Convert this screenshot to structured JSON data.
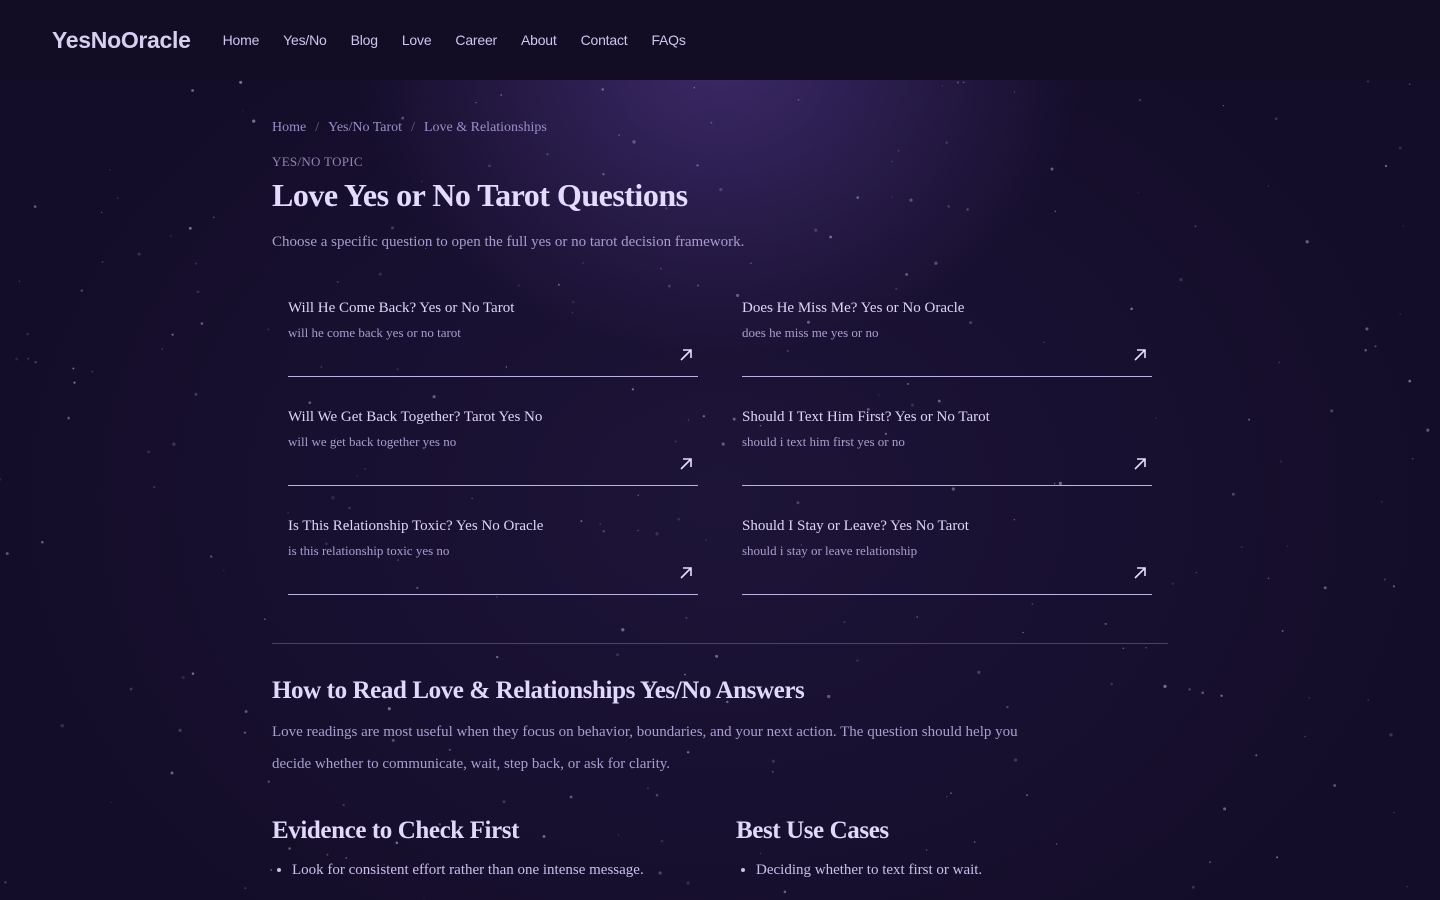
{
  "site": {
    "brand": "YesNoOracle",
    "nav": [
      "Home",
      "Yes/No",
      "Blog",
      "Love",
      "Career",
      "About",
      "Contact",
      "FAQs"
    ]
  },
  "breadcrumb": [
    "Home",
    "Yes/No Tarot",
    "Love & Relationships"
  ],
  "eyebrow": "YES/NO TOPIC",
  "title": "Love Yes or No Tarot Questions",
  "intro": "Choose a specific question to open the full yes or no tarot decision framework.",
  "cards": [
    {
      "title": "Will He Come Back? Yes or No Tarot",
      "subtitle": "will he come back yes or no tarot"
    },
    {
      "title": "Does He Miss Me? Yes or No Oracle",
      "subtitle": "does he miss me yes or no"
    },
    {
      "title": "Will We Get Back Together? Tarot Yes No",
      "subtitle": "will we get back together yes no"
    },
    {
      "title": "Should I Text Him First? Yes or No Tarot",
      "subtitle": "should i text him first yes or no"
    },
    {
      "title": "Is This Relationship Toxic? Yes No Oracle",
      "subtitle": "is this relationship toxic yes no"
    },
    {
      "title": "Should I Stay or Leave? Yes No Tarot",
      "subtitle": "should i stay or leave relationship"
    }
  ],
  "howto": {
    "heading": "How to Read Love & Relationships Yes/No Answers",
    "body": "Love readings are most useful when they focus on behavior, boundaries, and your next action. The question should help you decide whether to communicate, wait, step back, or ask for clarity."
  },
  "evidence": {
    "heading": "Evidence to Check First",
    "items": [
      "Look for consistent effort rather than one intense message."
    ]
  },
  "use_cases": {
    "heading": "Best Use Cases",
    "items": [
      "Deciding whether to text first or wait."
    ]
  },
  "icons": {
    "card_link": "arrow-up-right-icon"
  },
  "colors": {
    "background": "#1a1233",
    "nav_bg": "#120c24",
    "title": "#e3dcff",
    "muted": "#a89fcf"
  }
}
